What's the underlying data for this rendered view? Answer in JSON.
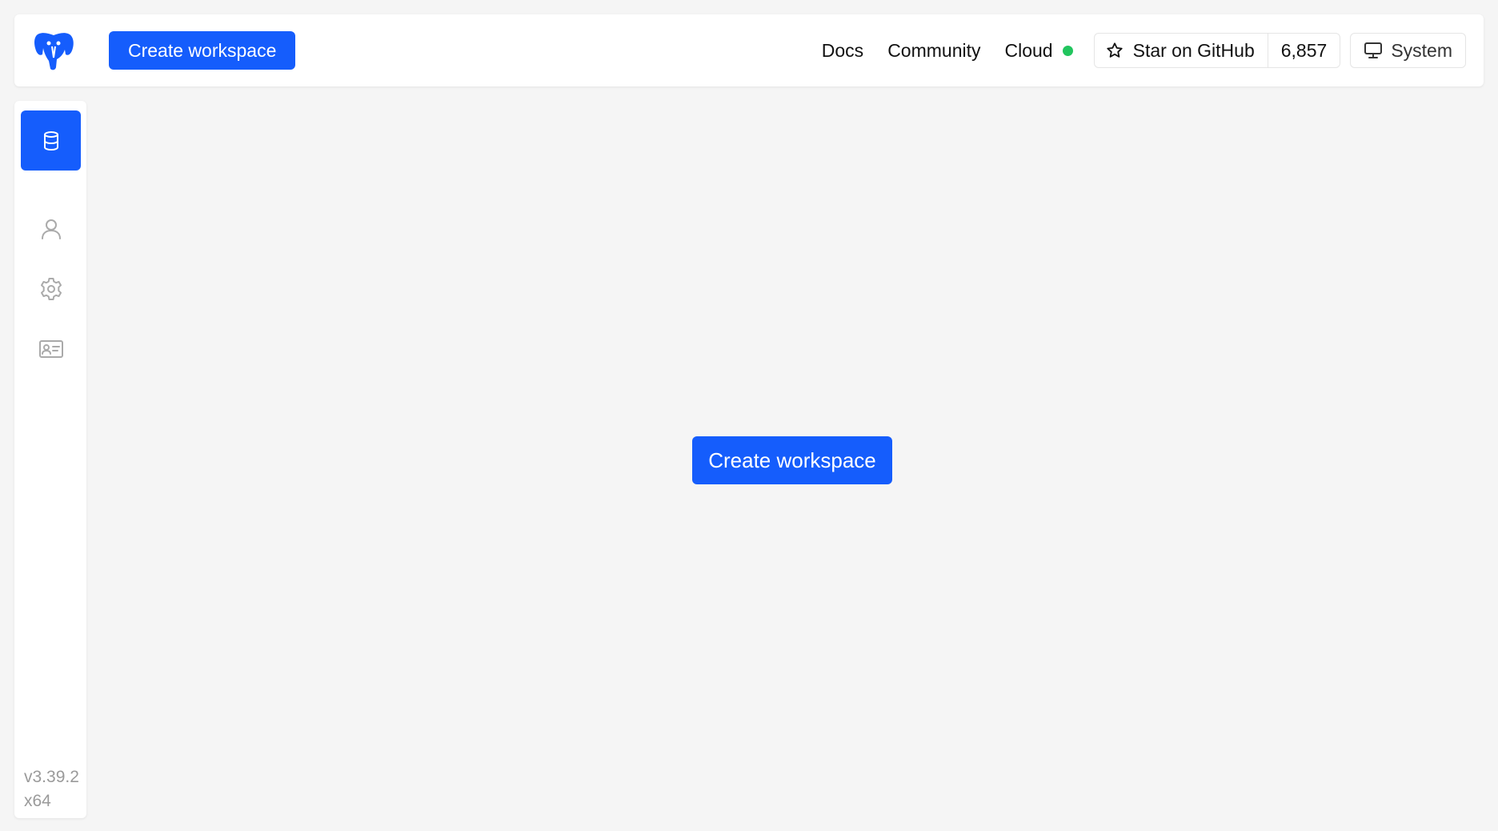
{
  "header": {
    "create_label": "Create workspace",
    "nav": {
      "docs": "Docs",
      "community": "Community",
      "cloud": "Cloud"
    },
    "github": {
      "star_label": "Star on GitHub",
      "count": "6,857"
    },
    "theme_label": "System"
  },
  "sidebar": {
    "items": [
      {
        "icon": "database-icon",
        "active": true
      },
      {
        "icon": "user-icon",
        "active": false
      },
      {
        "icon": "gear-icon",
        "active": false
      },
      {
        "icon": "id-card-icon",
        "active": false
      }
    ],
    "version": "v3.39.2",
    "arch": "x64"
  },
  "main": {
    "create_label": "Create workspace"
  },
  "colors": {
    "accent": "#155dfc",
    "status_online": "#22c55e",
    "background": "#f5f5f5"
  }
}
